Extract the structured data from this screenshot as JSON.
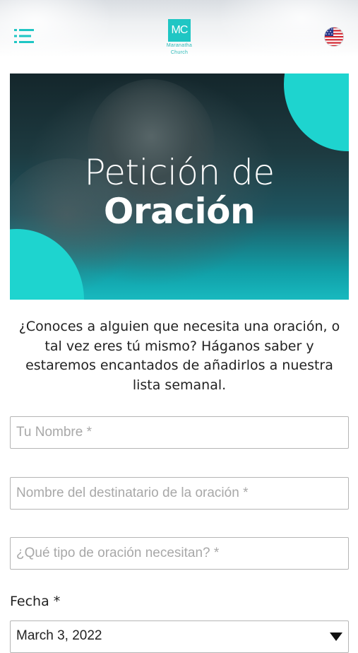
{
  "header": {
    "logo_initials": "MC",
    "logo_line1": "Maranatha",
    "logo_line2": "Church",
    "menu_icon": "hamburger-menu-icon",
    "language_icon": "us-flag-icon"
  },
  "banner": {
    "title_line1": "Petición de",
    "title_line2": "Oración",
    "accent_color": "#1ed4cf"
  },
  "intro_text": "¿Conoces a alguien que necesita una oración, o tal vez eres tú mismo? Háganos saber y estaremos encantados de añadirlos a nuestra lista semanal.",
  "form": {
    "name_placeholder": "Tu Nombre *",
    "recipient_placeholder": "Nombre del destinatario de la oración *",
    "prayer_type_placeholder": "¿Qué tipo de oración necesitan? *",
    "date_label": "Fecha *",
    "date_value": "March 3, 2022"
  }
}
